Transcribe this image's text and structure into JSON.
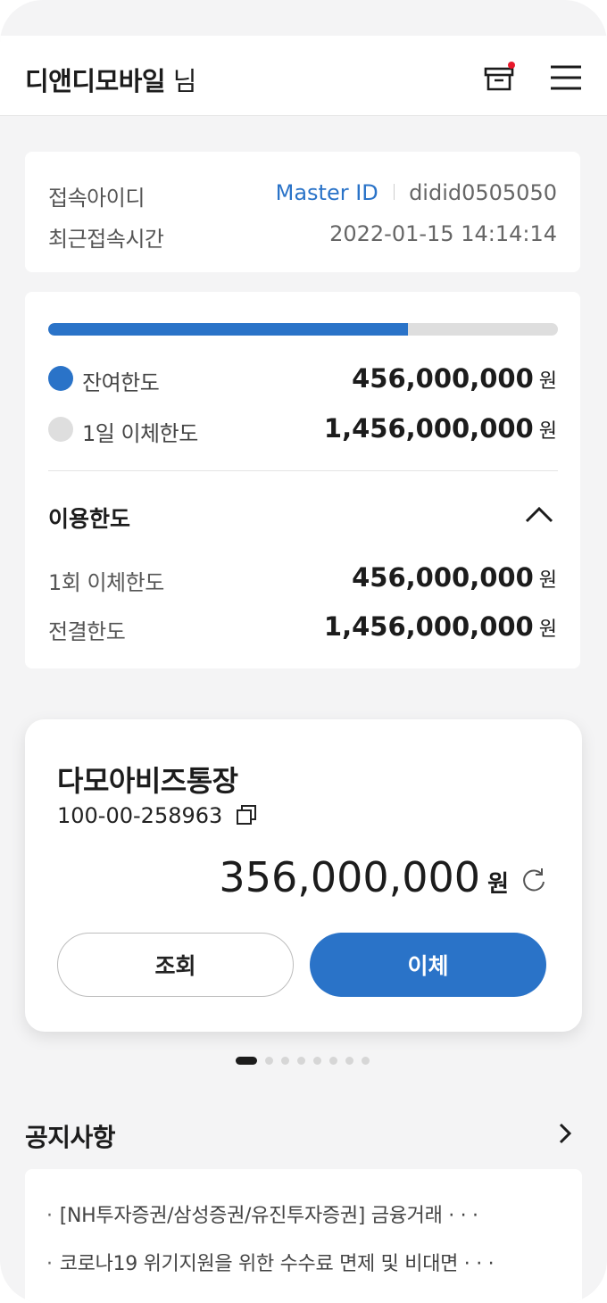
{
  "header": {
    "user_name": "디앤디모바일",
    "user_suffix": " 님"
  },
  "login_info": {
    "id_label": "접속아이디",
    "id_badge": "Master ID",
    "id_value": "didid0505050",
    "time_label": "최근접속시간",
    "time_value": "2022-01-15 14:14:14"
  },
  "limits": {
    "progress_fraction": 0.705,
    "remaining_label": "잔여한도",
    "remaining_amount": "456,000,000",
    "daily_label": "1일 이체한도",
    "daily_amount": "1,456,000,000",
    "usage_title": "이용한도",
    "per_tx_label": "1회 이체한도",
    "per_tx_amount": "456,000,000",
    "approval_label": "전결한도",
    "approval_amount": "1,456,000,000",
    "unit": "원",
    "colors": {
      "remaining": "#2a73c8",
      "daily": "#dedede"
    }
  },
  "account": {
    "name": "다모아비즈통장",
    "number": "100-00-258963",
    "balance": "356,000,000",
    "unit": "원",
    "query_label": "조회",
    "transfer_label": "이체"
  },
  "pager": {
    "count": 8,
    "active": 0
  },
  "notices": {
    "title": "공지사항",
    "bullet": "·",
    "items": [
      "[NH투자증권/삼성증권/유진투자증권] 금융거래 · · ·",
      "코로나19 위기지원을 위한 수수료 면제 및 비대면  · · ·"
    ]
  },
  "icons": {
    "mailbox": "mailbox-icon",
    "menu": "hamburger-menu-icon",
    "collapse": "chevron-up-icon",
    "copy": "copy-icon",
    "refresh": "refresh-icon",
    "more": "chevron-right-icon"
  },
  "colors": {
    "accent": "#2a73c8",
    "notification_dot": "#e8192c"
  }
}
